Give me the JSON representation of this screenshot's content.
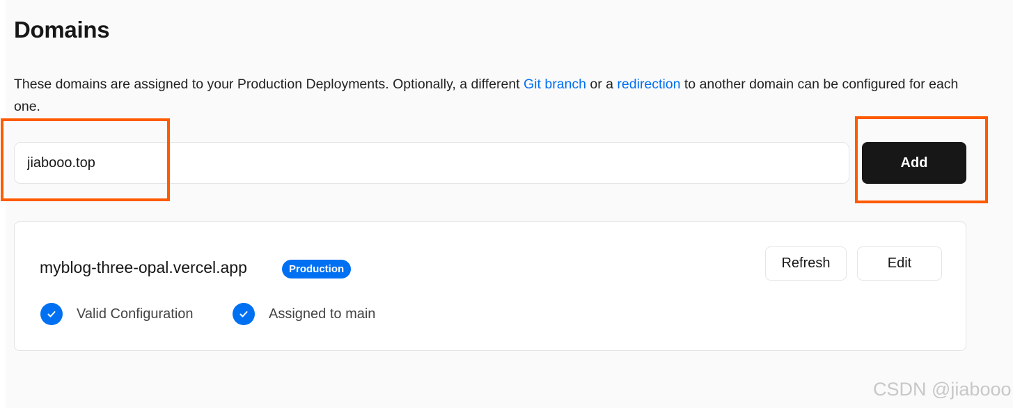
{
  "page": {
    "title": "Domains"
  },
  "description": {
    "before": "These domains are assigned to your Production Deployments. Optionally, a different ",
    "link1": "Git branch",
    "middle": " or a ",
    "link2": "redirection",
    "after": " to another domain can be configured for each one."
  },
  "add_form": {
    "input_value": "jiabooo.top",
    "add_label": "Add"
  },
  "domains": [
    {
      "name": "myblog-three-opal.vercel.app",
      "badge": "Production",
      "refresh_label": "Refresh",
      "edit_label": "Edit",
      "statuses": [
        {
          "label": "Valid Configuration",
          "icon": "check-circle-icon"
        },
        {
          "label": "Assigned to main",
          "icon": "check-circle-icon"
        }
      ]
    }
  ],
  "colors": {
    "accent": "#0070f3",
    "highlight": "#ff5a00",
    "primary_button": "#171717"
  },
  "watermark": "CSDN @jiabooo"
}
